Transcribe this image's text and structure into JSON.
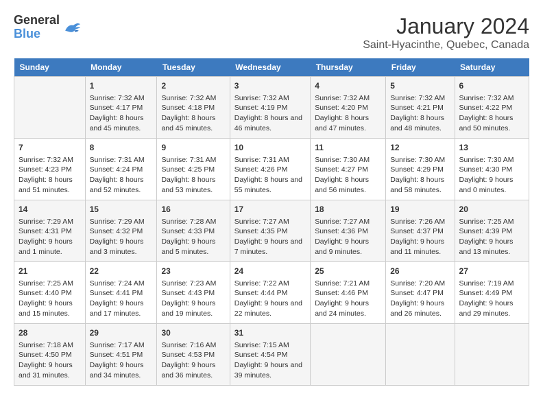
{
  "logo": {
    "general": "General",
    "blue": "Blue"
  },
  "title": "January 2024",
  "subtitle": "Saint-Hyacinthe, Quebec, Canada",
  "weekdays": [
    "Sunday",
    "Monday",
    "Tuesday",
    "Wednesday",
    "Thursday",
    "Friday",
    "Saturday"
  ],
  "weeks": [
    [
      {
        "day": "",
        "sunrise": "",
        "sunset": "",
        "daylight": ""
      },
      {
        "day": "1",
        "sunrise": "Sunrise: 7:32 AM",
        "sunset": "Sunset: 4:17 PM",
        "daylight": "Daylight: 8 hours and 45 minutes."
      },
      {
        "day": "2",
        "sunrise": "Sunrise: 7:32 AM",
        "sunset": "Sunset: 4:18 PM",
        "daylight": "Daylight: 8 hours and 45 minutes."
      },
      {
        "day": "3",
        "sunrise": "Sunrise: 7:32 AM",
        "sunset": "Sunset: 4:19 PM",
        "daylight": "Daylight: 8 hours and 46 minutes."
      },
      {
        "day": "4",
        "sunrise": "Sunrise: 7:32 AM",
        "sunset": "Sunset: 4:20 PM",
        "daylight": "Daylight: 8 hours and 47 minutes."
      },
      {
        "day": "5",
        "sunrise": "Sunrise: 7:32 AM",
        "sunset": "Sunset: 4:21 PM",
        "daylight": "Daylight: 8 hours and 48 minutes."
      },
      {
        "day": "6",
        "sunrise": "Sunrise: 7:32 AM",
        "sunset": "Sunset: 4:22 PM",
        "daylight": "Daylight: 8 hours and 50 minutes."
      }
    ],
    [
      {
        "day": "7",
        "sunrise": "Sunrise: 7:32 AM",
        "sunset": "Sunset: 4:23 PM",
        "daylight": "Daylight: 8 hours and 51 minutes."
      },
      {
        "day": "8",
        "sunrise": "Sunrise: 7:31 AM",
        "sunset": "Sunset: 4:24 PM",
        "daylight": "Daylight: 8 hours and 52 minutes."
      },
      {
        "day": "9",
        "sunrise": "Sunrise: 7:31 AM",
        "sunset": "Sunset: 4:25 PM",
        "daylight": "Daylight: 8 hours and 53 minutes."
      },
      {
        "day": "10",
        "sunrise": "Sunrise: 7:31 AM",
        "sunset": "Sunset: 4:26 PM",
        "daylight": "Daylight: 8 hours and 55 minutes."
      },
      {
        "day": "11",
        "sunrise": "Sunrise: 7:30 AM",
        "sunset": "Sunset: 4:27 PM",
        "daylight": "Daylight: 8 hours and 56 minutes."
      },
      {
        "day": "12",
        "sunrise": "Sunrise: 7:30 AM",
        "sunset": "Sunset: 4:29 PM",
        "daylight": "Daylight: 8 hours and 58 minutes."
      },
      {
        "day": "13",
        "sunrise": "Sunrise: 7:30 AM",
        "sunset": "Sunset: 4:30 PM",
        "daylight": "Daylight: 9 hours and 0 minutes."
      }
    ],
    [
      {
        "day": "14",
        "sunrise": "Sunrise: 7:29 AM",
        "sunset": "Sunset: 4:31 PM",
        "daylight": "Daylight: 9 hours and 1 minute."
      },
      {
        "day": "15",
        "sunrise": "Sunrise: 7:29 AM",
        "sunset": "Sunset: 4:32 PM",
        "daylight": "Daylight: 9 hours and 3 minutes."
      },
      {
        "day": "16",
        "sunrise": "Sunrise: 7:28 AM",
        "sunset": "Sunset: 4:33 PM",
        "daylight": "Daylight: 9 hours and 5 minutes."
      },
      {
        "day": "17",
        "sunrise": "Sunrise: 7:27 AM",
        "sunset": "Sunset: 4:35 PM",
        "daylight": "Daylight: 9 hours and 7 minutes."
      },
      {
        "day": "18",
        "sunrise": "Sunrise: 7:27 AM",
        "sunset": "Sunset: 4:36 PM",
        "daylight": "Daylight: 9 hours and 9 minutes."
      },
      {
        "day": "19",
        "sunrise": "Sunrise: 7:26 AM",
        "sunset": "Sunset: 4:37 PM",
        "daylight": "Daylight: 9 hours and 11 minutes."
      },
      {
        "day": "20",
        "sunrise": "Sunrise: 7:25 AM",
        "sunset": "Sunset: 4:39 PM",
        "daylight": "Daylight: 9 hours and 13 minutes."
      }
    ],
    [
      {
        "day": "21",
        "sunrise": "Sunrise: 7:25 AM",
        "sunset": "Sunset: 4:40 PM",
        "daylight": "Daylight: 9 hours and 15 minutes."
      },
      {
        "day": "22",
        "sunrise": "Sunrise: 7:24 AM",
        "sunset": "Sunset: 4:41 PM",
        "daylight": "Daylight: 9 hours and 17 minutes."
      },
      {
        "day": "23",
        "sunrise": "Sunrise: 7:23 AM",
        "sunset": "Sunset: 4:43 PM",
        "daylight": "Daylight: 9 hours and 19 minutes."
      },
      {
        "day": "24",
        "sunrise": "Sunrise: 7:22 AM",
        "sunset": "Sunset: 4:44 PM",
        "daylight": "Daylight: 9 hours and 22 minutes."
      },
      {
        "day": "25",
        "sunrise": "Sunrise: 7:21 AM",
        "sunset": "Sunset: 4:46 PM",
        "daylight": "Daylight: 9 hours and 24 minutes."
      },
      {
        "day": "26",
        "sunrise": "Sunrise: 7:20 AM",
        "sunset": "Sunset: 4:47 PM",
        "daylight": "Daylight: 9 hours and 26 minutes."
      },
      {
        "day": "27",
        "sunrise": "Sunrise: 7:19 AM",
        "sunset": "Sunset: 4:49 PM",
        "daylight": "Daylight: 9 hours and 29 minutes."
      }
    ],
    [
      {
        "day": "28",
        "sunrise": "Sunrise: 7:18 AM",
        "sunset": "Sunset: 4:50 PM",
        "daylight": "Daylight: 9 hours and 31 minutes."
      },
      {
        "day": "29",
        "sunrise": "Sunrise: 7:17 AM",
        "sunset": "Sunset: 4:51 PM",
        "daylight": "Daylight: 9 hours and 34 minutes."
      },
      {
        "day": "30",
        "sunrise": "Sunrise: 7:16 AM",
        "sunset": "Sunset: 4:53 PM",
        "daylight": "Daylight: 9 hours and 36 minutes."
      },
      {
        "day": "31",
        "sunrise": "Sunrise: 7:15 AM",
        "sunset": "Sunset: 4:54 PM",
        "daylight": "Daylight: 9 hours and 39 minutes."
      },
      {
        "day": "",
        "sunrise": "",
        "sunset": "",
        "daylight": ""
      },
      {
        "day": "",
        "sunrise": "",
        "sunset": "",
        "daylight": ""
      },
      {
        "day": "",
        "sunrise": "",
        "sunset": "",
        "daylight": ""
      }
    ]
  ]
}
